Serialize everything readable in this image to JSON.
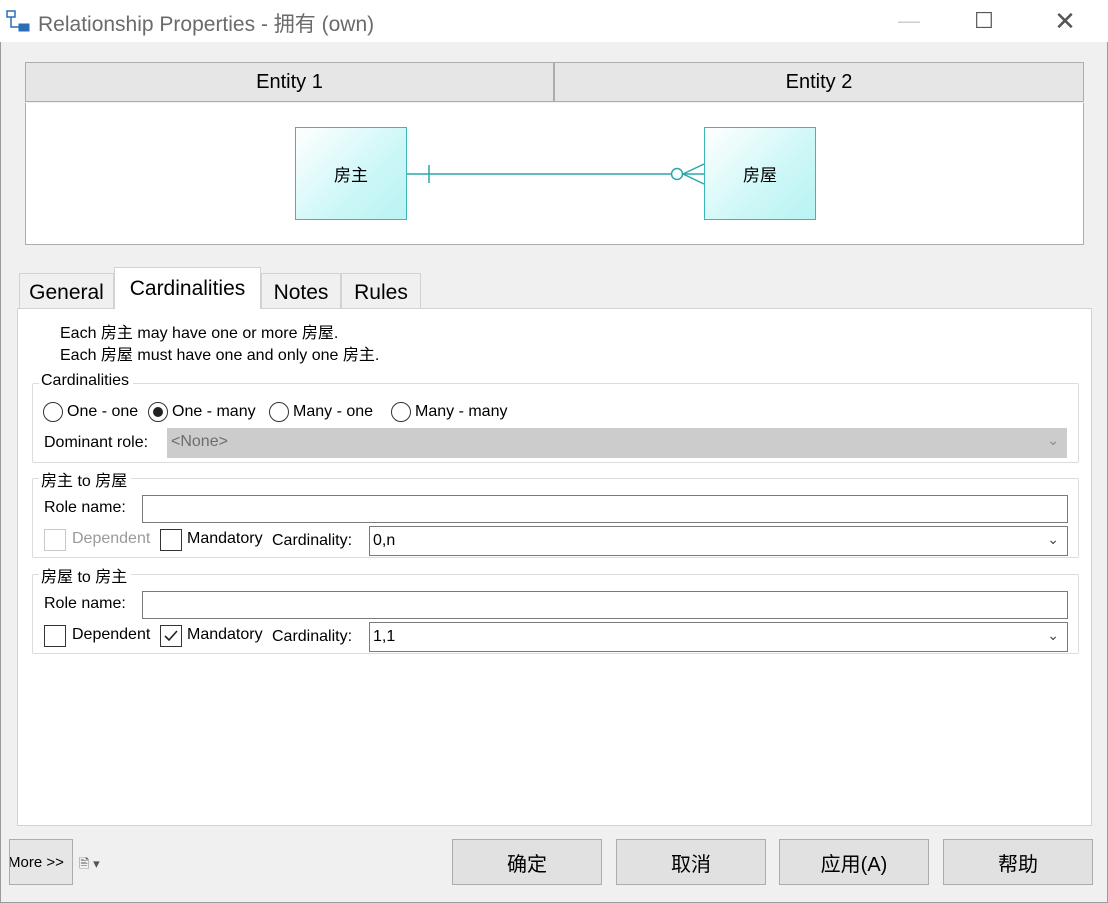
{
  "window": {
    "title": "Relationship Properties - 拥有 (own)",
    "minimize_glyph": "—",
    "maximize_glyph": "☐",
    "close_glyph": "✕"
  },
  "entities": {
    "entity1_header": "Entity 1",
    "entity2_header": "Entity 2",
    "entity1_name": "房主",
    "entity2_name": "房屋"
  },
  "tabs": [
    {
      "label": "General"
    },
    {
      "label": "Cardinalities",
      "active": true
    },
    {
      "label": "Notes"
    },
    {
      "label": "Rules"
    }
  ],
  "summary": {
    "line1_prefix": "Each ",
    "line1_entity1": "房主",
    "line1_middle": " may have one or more ",
    "line1_entity2": "房屋",
    "line1_suffix": ".",
    "line2_prefix": "Each ",
    "line2_entity1": "房屋",
    "line2_middle": " must have one and only one ",
    "line2_entity2": "房主",
    "line2_suffix": "."
  },
  "cardinalities_group": {
    "label": "Cardinalities",
    "options": [
      {
        "label": "One - one",
        "selected": false
      },
      {
        "label": "One - many",
        "selected": true
      },
      {
        "label": "Many - one",
        "selected": false
      },
      {
        "label": "Many - many",
        "selected": false
      }
    ],
    "dominant_role_label": "Dominant role:",
    "dominant_role_value": "<None>"
  },
  "role1": {
    "label_from": "房主",
    "label_to_word": " to ",
    "label_to": "房屋",
    "role_name_label": "Role name:",
    "role_name_value": "",
    "dependent_label": "Dependent",
    "dependent_checked": false,
    "dependent_enabled": false,
    "mandatory_label": "Mandatory",
    "mandatory_checked": false,
    "cardinality_label": "Cardinality:",
    "cardinality_value": "0,n"
  },
  "role2": {
    "label_from": "房屋",
    "label_to_word": " to ",
    "label_to": "房主",
    "role_name_label": "Role name:",
    "role_name_value": "",
    "dependent_label": "Dependent",
    "dependent_checked": false,
    "dependent_enabled": true,
    "mandatory_label": "Mandatory",
    "mandatory_checked": true,
    "cardinality_label": "Cardinality:",
    "cardinality_value": "1,1"
  },
  "footer": {
    "more_label": "More >>",
    "ok_label": "确定",
    "cancel_label": "取消",
    "apply_label": "应用(A)",
    "help_label": "帮助"
  },
  "colors": {
    "entity_border": "#3cb7b7",
    "relationship_line": "#2aa7a7",
    "disabled_field": "#cccccc"
  }
}
